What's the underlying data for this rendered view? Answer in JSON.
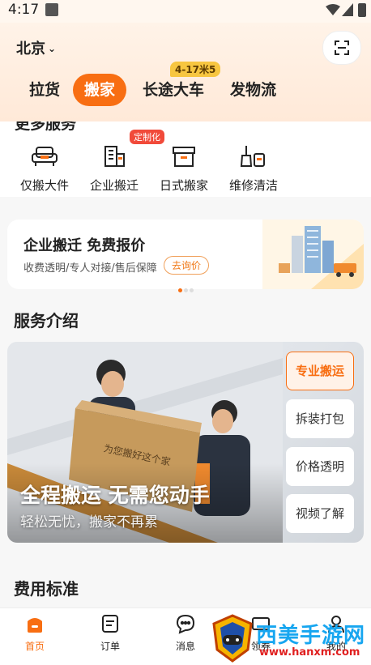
{
  "status": {
    "time": "4:17"
  },
  "header": {
    "city": "北京",
    "tabs": [
      {
        "label": "拉货"
      },
      {
        "label": "搬家",
        "active": true
      },
      {
        "label": "长途大车",
        "badge": "4-17米5"
      },
      {
        "label": "发物流"
      }
    ]
  },
  "more_services": {
    "title": "更多服务",
    "items": [
      {
        "label": "仅搬大件",
        "icon": "sofa-icon"
      },
      {
        "label": "企业搬迁",
        "icon": "office-building-icon",
        "tag": "定制化"
      },
      {
        "label": "日式搬家",
        "icon": "storage-box-icon"
      },
      {
        "label": "维修清洁",
        "icon": "cleaning-icon"
      }
    ]
  },
  "promo": {
    "title": "企业搬迁 免费报价",
    "subtitle": "收费透明/专人对接/售后保障",
    "button": "去询价"
  },
  "intro": {
    "title": "服务介绍",
    "banner_heading": "全程搬运 无需您动手",
    "banner_sub": "轻松无忧，搬家不再累",
    "box_text": "为您搬好这个家",
    "side_buttons": [
      "专业搬运",
      "拆装打包",
      "价格透明",
      "视频了解"
    ]
  },
  "fees": {
    "title": "费用标准"
  },
  "nav": {
    "items": [
      {
        "label": "首页",
        "icon": "home-icon",
        "active": true
      },
      {
        "label": "订单",
        "icon": "order-icon"
      },
      {
        "label": "消息",
        "icon": "message-icon"
      },
      {
        "label": "领券",
        "icon": "coupon-icon"
      },
      {
        "label": "我的",
        "icon": "profile-icon"
      }
    ]
  },
  "watermark": {
    "title": "西美手游网",
    "url": "www.hanxm.com"
  },
  "colors": {
    "accent": "#f86e12",
    "badge": "#f7c640",
    "tag": "#f14a3a"
  }
}
